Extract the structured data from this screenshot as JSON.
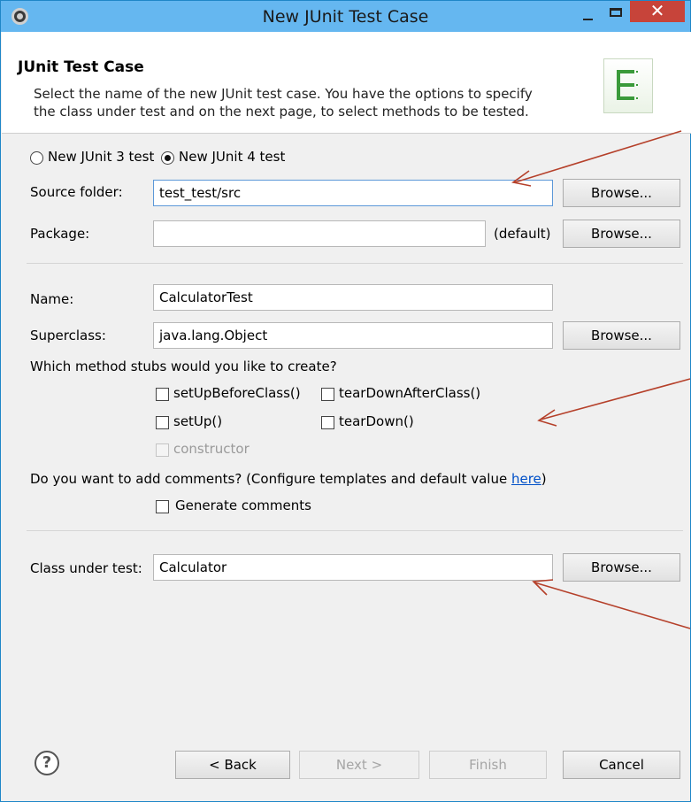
{
  "window": {
    "title": "New JUnit Test Case",
    "close_glyph": "✕"
  },
  "header": {
    "title": "JUnit Test Case",
    "description": "Select the name of the new JUnit test case. You have the options to specify\nthe class under test and on the next page, to select methods to be tested.",
    "icon": "junit-test-icon"
  },
  "version": {
    "junit3": {
      "label": "New JUnit 3 test",
      "selected": false
    },
    "junit4": {
      "label": "New JUnit 4 test",
      "selected": true
    }
  },
  "source_folder": {
    "label": "Source folder:",
    "value": "test_test/src",
    "browse": "Browse..."
  },
  "package": {
    "label": "Package:",
    "value": "",
    "hint": "(default)",
    "browse": "Browse..."
  },
  "name": {
    "label": "Name:",
    "value": "CalculatorTest"
  },
  "superclass": {
    "label": "Superclass:",
    "value": "java.lang.Object",
    "browse": "Browse..."
  },
  "stubs": {
    "question": "Which method stubs would you like to create?",
    "setUpBeforeClass": {
      "label": "setUpBeforeClass()",
      "checked": false
    },
    "tearDownAfterClass": {
      "label": "tearDownAfterClass()",
      "checked": false
    },
    "setUp": {
      "label": "setUp()",
      "checked": false
    },
    "tearDown": {
      "label": "tearDown()",
      "checked": false
    },
    "constructor": {
      "label": "constructor",
      "checked": false,
      "enabled": false
    }
  },
  "comments": {
    "question": "Do you want to add comments? (Configure templates and default value ",
    "link": "here",
    "close_paren": ")",
    "generate": {
      "label": "Generate comments",
      "checked": false
    }
  },
  "class_under_test": {
    "label": "Class under test:",
    "value": "Calculator",
    "browse": "Browse..."
  },
  "footer": {
    "help": "?",
    "back": "< Back",
    "next": "Next >",
    "finish": "Finish",
    "cancel": "Cancel"
  },
  "colors": {
    "accent": "#65b7f0",
    "close": "#c7443a",
    "annotation": "#b5402a",
    "link": "#0050c8"
  }
}
